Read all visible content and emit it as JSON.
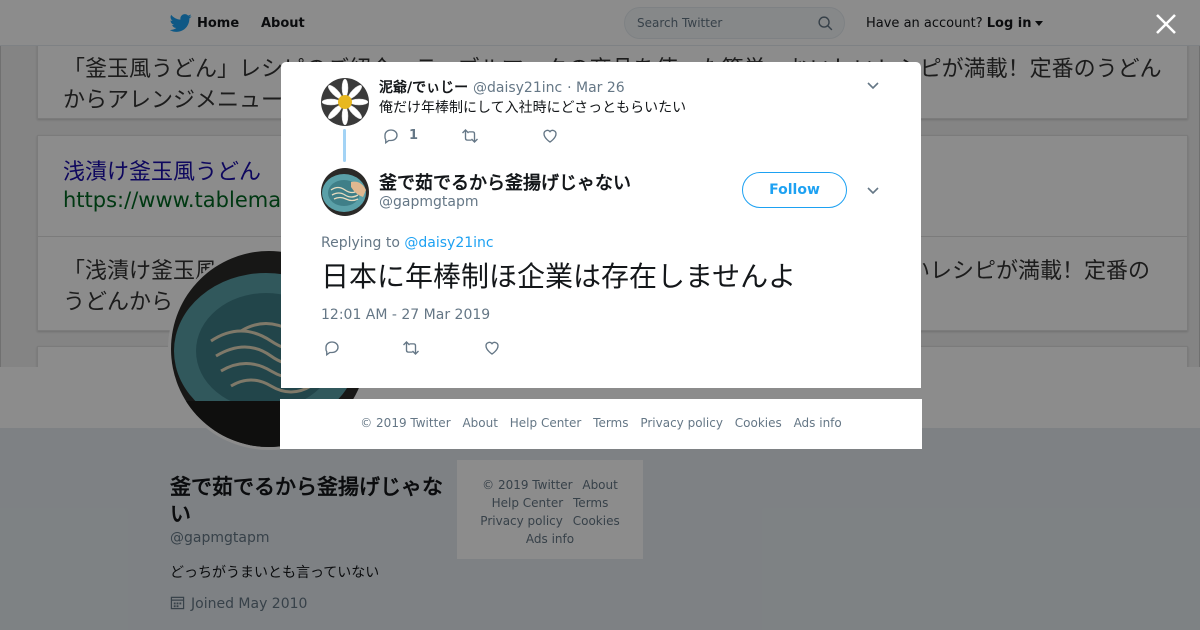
{
  "topbar": {
    "home_label": "Home",
    "about_label": "About",
    "search_placeholder": "Search Twitter",
    "account_prompt": "Have an account?",
    "login_label": "Log in"
  },
  "background_cards": {
    "card1_line1": "「釜玉風うどん」レシピのご紹介。テーブルマークの商品を使った簡単、おいしいレシピが満載！定番のうどん",
    "card1_line2": "からアレンジメニュー",
    "card2_title": "浅漬け釜玉風うどん",
    "card2_url": "https://www.tablemark",
    "card3_line1": "「浅漬け釜玉風",
    "card3_line1_right": "いレシピが満載！定番の",
    "card3_line2": "うどんから"
  },
  "profile": {
    "name": "釜で茹でるから釜揚げじゃない",
    "handle": "@gapmgtapm",
    "bio": "どっちがうまいとも言っていない",
    "joined": "Joined May 2010"
  },
  "side_footer": {
    "copyright": "© 2019 Twitter",
    "about": "About",
    "help": "Help Center",
    "terms": "Terms",
    "privacy": "Privacy policy",
    "cookies": "Cookies",
    "ads": "Ads info"
  },
  "parent_tweet": {
    "name": "泥爺/でぃじー",
    "handle": "@daisy21inc",
    "date": "· Mar 26",
    "text": "俺だけ年棒制にして入社時にどさっともらいたい",
    "reply_count": "1"
  },
  "main_tweet": {
    "name": "釜で茹でるから釜揚げじゃない",
    "handle": "@gapmgtapm",
    "follow_label": "Follow",
    "replying_prefix": "Replying to",
    "replying_handle": "@daisy21inc",
    "text": "日本に年棒制ほ企業は存在しませんよ",
    "timestamp": "12:01 AM - 27 Mar 2019"
  },
  "modal_footer": {
    "copyright": "© 2019 Twitter",
    "about": "About",
    "help": "Help Center",
    "terms": "Terms",
    "privacy": "Privacy policy",
    "cookies": "Cookies",
    "ads": "Ads info"
  },
  "colors": {
    "accent": "#1da1f2",
    "text": "#14171a",
    "muted": "#657786",
    "overlay": "rgba(0,0,0,0.45)"
  },
  "icons": {
    "logo": "twitter-bird-icon",
    "search": "search-icon",
    "close": "close-icon",
    "reply": "reply-icon",
    "retweet": "retweet-icon",
    "like": "heart-icon",
    "menu": "chevron-down-icon",
    "calendar": "calendar-icon"
  }
}
